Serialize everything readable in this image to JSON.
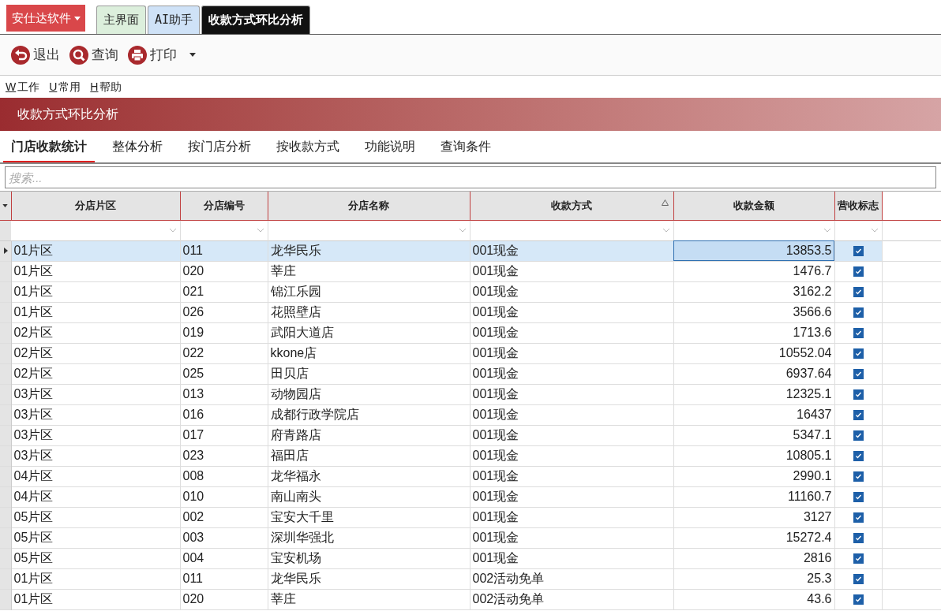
{
  "app_menu": {
    "label": "安仕达软件"
  },
  "doc_tabs": [
    {
      "label": "主界面",
      "kind": "home",
      "selected": false
    },
    {
      "label": "AI助手",
      "kind": "ai",
      "selected": false
    },
    {
      "label": "收款方式环比分析",
      "kind": "doc",
      "selected": true
    }
  ],
  "toolbar": [
    {
      "label": "退出",
      "kind": "exit"
    },
    {
      "label": "查询",
      "kind": "search"
    },
    {
      "label": "打印",
      "kind": "print",
      "dropdown": true
    }
  ],
  "menu": [
    {
      "key": "W",
      "label": "工作"
    },
    {
      "key": "U",
      "label": "常用"
    },
    {
      "key": "H",
      "label": "帮助"
    }
  ],
  "banner": {
    "title": "收款方式环比分析"
  },
  "tabs": [
    {
      "label": "门店收款统计",
      "selected": true
    },
    {
      "label": "整体分析",
      "selected": false
    },
    {
      "label": "按门店分析",
      "selected": false
    },
    {
      "label": "按收款方式",
      "selected": false
    },
    {
      "label": "功能说明",
      "selected": false
    },
    {
      "label": "查询条件",
      "selected": false
    }
  ],
  "search": {
    "placeholder": "搜索..."
  },
  "table": {
    "columns": [
      {
        "label": "分店片区",
        "sorted": false
      },
      {
        "label": "分店编号",
        "sorted": false
      },
      {
        "label": "分店名称",
        "sorted": false
      },
      {
        "label": "收款方式",
        "sorted": true
      },
      {
        "label": "收款金额",
        "sorted": false
      },
      {
        "label": "营收标志",
        "sorted": false
      }
    ],
    "rows": [
      {
        "cells": [
          "01片区",
          "011",
          "龙华民乐",
          "001现金",
          "13853.5"
        ],
        "flag": true,
        "selected": true
      },
      {
        "cells": [
          "01片区",
          "020",
          "莘庄",
          "001现金",
          "1476.7"
        ],
        "flag": true,
        "selected": false
      },
      {
        "cells": [
          "01片区",
          "021",
          "锦江乐园",
          "001现金",
          "3162.2"
        ],
        "flag": true,
        "selected": false
      },
      {
        "cells": [
          "01片区",
          "026",
          "花照壁店",
          "001现金",
          "3566.6"
        ],
        "flag": true,
        "selected": false
      },
      {
        "cells": [
          "02片区",
          "019",
          "武阳大道店",
          "001现金",
          "1713.6"
        ],
        "flag": true,
        "selected": false
      },
      {
        "cells": [
          "02片区",
          "022",
          "kkone店",
          "001现金",
          "10552.04"
        ],
        "flag": true,
        "selected": false
      },
      {
        "cells": [
          "02片区",
          "025",
          "田贝店",
          "001现金",
          "6937.64"
        ],
        "flag": true,
        "selected": false
      },
      {
        "cells": [
          "03片区",
          "013",
          "动物园店",
          "001现金",
          "12325.1"
        ],
        "flag": true,
        "selected": false
      },
      {
        "cells": [
          "03片区",
          "016",
          "成都行政学院店",
          "001现金",
          "16437"
        ],
        "flag": true,
        "selected": false
      },
      {
        "cells": [
          "03片区",
          "017",
          "府青路店",
          "001现金",
          "5347.1"
        ],
        "flag": true,
        "selected": false
      },
      {
        "cells": [
          "03片区",
          "023",
          "福田店",
          "001现金",
          "10805.1"
        ],
        "flag": true,
        "selected": false
      },
      {
        "cells": [
          "04片区",
          "008",
          "龙华福永",
          "001现金",
          "2990.1"
        ],
        "flag": true,
        "selected": false
      },
      {
        "cells": [
          "04片区",
          "010",
          "南山南头",
          "001现金",
          "11160.7"
        ],
        "flag": true,
        "selected": false
      },
      {
        "cells": [
          "05片区",
          "002",
          "宝安大千里",
          "001现金",
          "3127"
        ],
        "flag": true,
        "selected": false
      },
      {
        "cells": [
          "05片区",
          "003",
          "深圳华强北",
          "001现金",
          "15272.4"
        ],
        "flag": true,
        "selected": false
      },
      {
        "cells": [
          "05片区",
          "004",
          "宝安机场",
          "001现金",
          "2816"
        ],
        "flag": true,
        "selected": false
      },
      {
        "cells": [
          "01片区",
          "011",
          "龙华民乐",
          "002活动免单",
          "25.3"
        ],
        "flag": true,
        "selected": false
      },
      {
        "cells": [
          "01片区",
          "020",
          "莘庄",
          "002活动免单",
          "43.6"
        ],
        "flag": true,
        "selected": false
      }
    ]
  }
}
